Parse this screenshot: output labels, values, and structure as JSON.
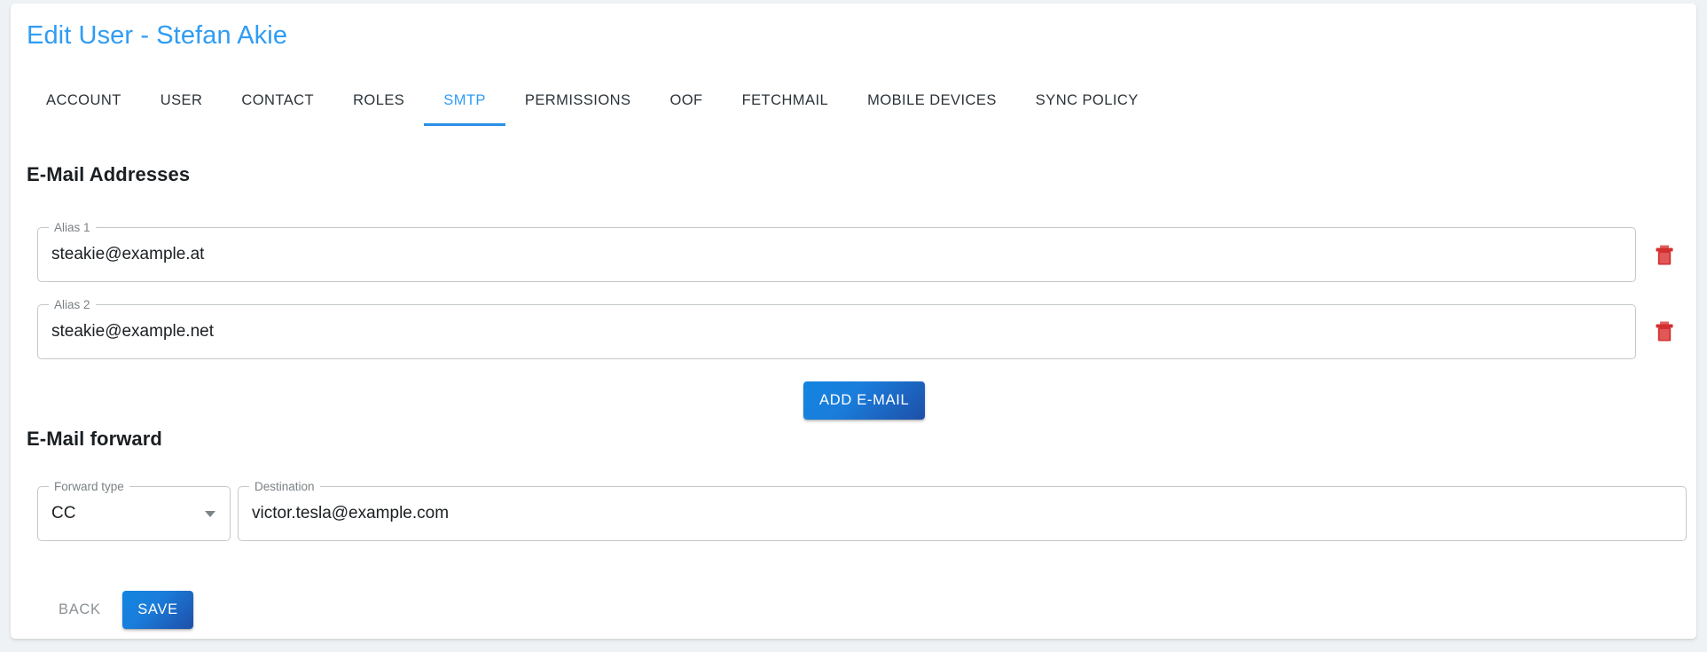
{
  "header": {
    "title": "Edit User - Stefan Akie",
    "title_color": "#2f9cf4"
  },
  "tabs": {
    "active": "SMTP",
    "accent_color": "#2990e8",
    "items": [
      {
        "label": "ACCOUNT"
      },
      {
        "label": "USER"
      },
      {
        "label": "CONTACT"
      },
      {
        "label": "ROLES"
      },
      {
        "label": "SMTP"
      },
      {
        "label": "PERMISSIONS"
      },
      {
        "label": "OOF"
      },
      {
        "label": "FETCHMAIL"
      },
      {
        "label": "MOBILE DEVICES"
      },
      {
        "label": "SYNC POLICY"
      }
    ]
  },
  "email_addresses": {
    "heading": "E-Mail Addresses",
    "aliases": [
      {
        "label": "Alias 1",
        "value": "steakie@example.at",
        "delete_icon": "trash-icon"
      },
      {
        "label": "Alias 2",
        "value": "steakie@example.net",
        "delete_icon": "trash-icon"
      }
    ],
    "add_button": "ADD E-MAIL",
    "delete_icon_color": "#d32f2f"
  },
  "email_forward": {
    "heading": "E-Mail forward",
    "forward_type": {
      "label": "Forward type",
      "value": "CC",
      "dropdown_icon": "chevron-down-icon"
    },
    "destination": {
      "label": "Destination",
      "value": "victor.tesla@example.com"
    }
  },
  "actions": {
    "back": "BACK",
    "save": "SAVE"
  }
}
